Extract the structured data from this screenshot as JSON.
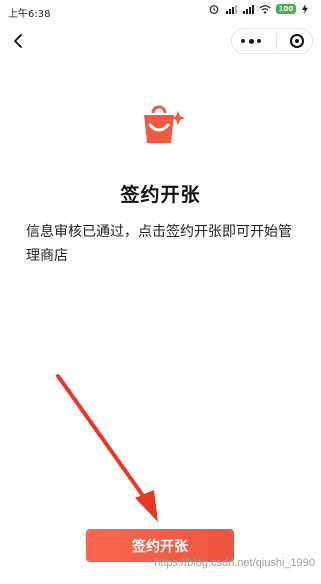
{
  "status_bar": {
    "time": "上午6:38",
    "battery": "100"
  },
  "page": {
    "title": "签约开张",
    "description": "信息审核已通过，点击签约开张即可开始管理商店"
  },
  "button": {
    "label": "签约开张"
  },
  "watermark": "https://blog.csdn.net/qiushi_1990",
  "colors": {
    "accent": "#f25a43",
    "arrow": "#e8382a"
  },
  "icons": [
    "back-icon",
    "more-icon",
    "close-target-icon",
    "shopping-bag-icon"
  ]
}
